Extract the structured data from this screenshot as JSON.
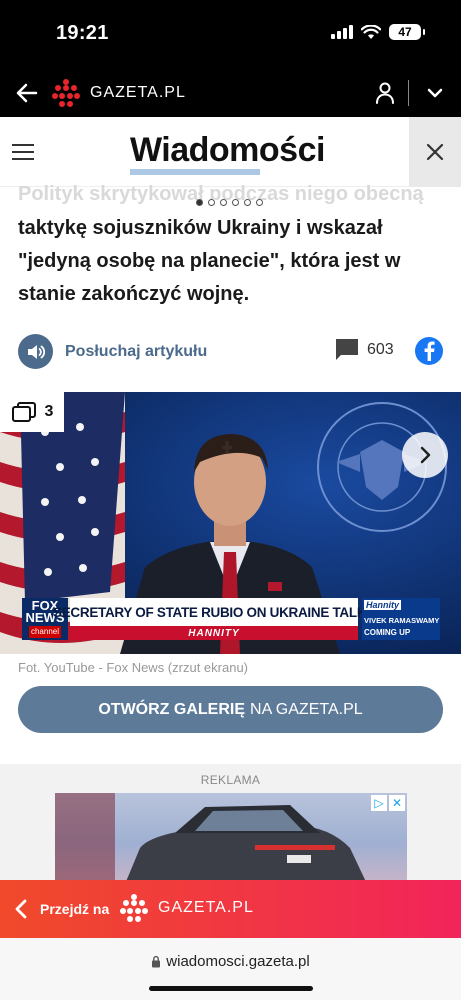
{
  "status_bar": {
    "time": "19:21",
    "battery": "47"
  },
  "header": {
    "brand": "GAZETA.PL"
  },
  "nav": {
    "section_title": "Wiadomości"
  },
  "article": {
    "faded_line": "Polityk skrytykował podczas niego obecną",
    "lead": "taktykę sojuszników Ukrainy i wskazał \"jedyną osobę na planecie\", która jest w stanie zakończyć wojnę.",
    "listen_label": "Posłuchaj artykułu",
    "comments_count": "603"
  },
  "gallery": {
    "count": "3",
    "chyron": {
      "logo_top": "FOX",
      "logo_mid": "NEWS",
      "logo_bottom": "channel",
      "headline": "SECRETARY OF STATE RUBIO ON UKRAINE TALKS",
      "show": "HANNITY",
      "side_show": "Hannity",
      "side_name": "VIVEK RAMASWAMY",
      "side_status": "COMING UP"
    },
    "caption": "Fot. YouTube - Fox News (zrzut ekranu)",
    "open_bold": "OTWÓRZ GALERIĘ",
    "open_rest": "NA GAZETA.PL"
  },
  "ad": {
    "label": "REKLAMA"
  },
  "banner": {
    "go_label": "Przejdź na",
    "brand": "GAZETA.PL"
  },
  "browser": {
    "url": "wiadomosci.gazeta.pl"
  },
  "colors": {
    "accent": "#4b6a8c",
    "banner_start": "#f04a2a",
    "banner_end": "#f2245a",
    "facebook": "#1877f2"
  }
}
